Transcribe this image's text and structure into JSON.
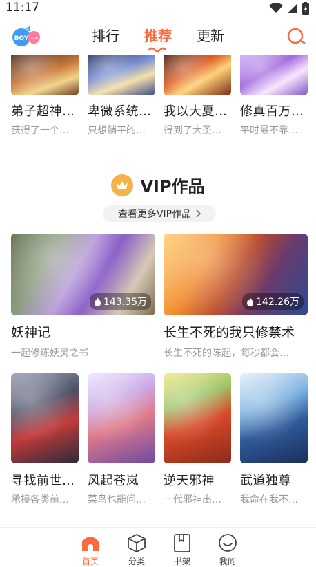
{
  "status_bar": {
    "time": "11:17"
  },
  "header": {
    "boy_label": "BOY",
    "girl_label": "GIRL",
    "tabs": [
      {
        "label": "排行"
      },
      {
        "label": "推荐",
        "active": true
      },
      {
        "label": "更新"
      }
    ]
  },
  "top_row": [
    {
      "title": "弟子超神…",
      "desc": "获得了一个…"
    },
    {
      "title": "卑微系统…",
      "desc": "只想躺平的…"
    },
    {
      "title": "我以大夏…",
      "desc": "得到了大圣…"
    },
    {
      "title": "修真百万…",
      "desc": "平时最不靠…"
    }
  ],
  "vip_section": {
    "title": "VIP作品",
    "more_label": "查看更多VIP作品",
    "featured": [
      {
        "title": "妖神记",
        "desc": "一起修炼妖灵之书",
        "views": "143.35万"
      },
      {
        "title": "长生不死的我只修禁术",
        "desc": "长生不死的陈起，每秒都会…",
        "views": "142.26万"
      }
    ],
    "grid": [
      {
        "title": "寻找前世…",
        "desc": "承接各类前…"
      },
      {
        "title": "风起苍岚",
        "desc": "菜鸟也能问…"
      },
      {
        "title": "逆天邪神",
        "desc": "一代邪神出…"
      },
      {
        "title": "武道独尊",
        "desc": "我命在我不…"
      }
    ]
  },
  "bottom_nav": [
    {
      "label": "首页",
      "icon": "home-icon",
      "active": true
    },
    {
      "label": "分类",
      "icon": "cube-icon"
    },
    {
      "label": "书架",
      "icon": "bookshelf-icon"
    },
    {
      "label": "我的",
      "icon": "profile-icon"
    }
  ],
  "colors": {
    "accent": "#ff6a3d",
    "crown": "#f6b24a",
    "boy_badge": "#3d9df5",
    "girl_badge": "#ff7a9a"
  }
}
